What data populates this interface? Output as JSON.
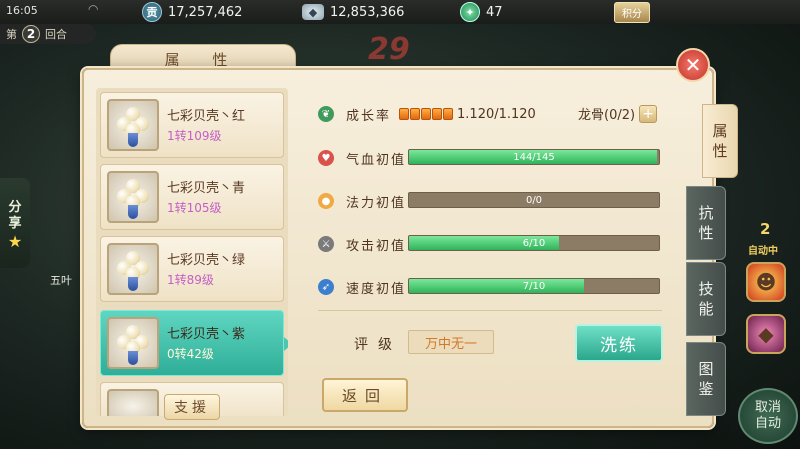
{
  "status_bar": {
    "time": "16:05",
    "gong_icon_char": "贡",
    "gong_value": "17,257,462",
    "silver_value": "12,853,366",
    "jade_value": "47",
    "points_label": "积分"
  },
  "battle": {
    "round_prefix": "第",
    "round_number": "2",
    "round_suffix": "回合",
    "big_number": "29",
    "share_label_1": "分",
    "share_label_2": "享",
    "side_unit_name": "五叶",
    "auto_count": "2",
    "auto_label": "自动中",
    "cancel_auto_label_1": "取消",
    "cancel_auto_label_2": "自动"
  },
  "panel": {
    "title": "属 性",
    "close_icon": "✕"
  },
  "pets": [
    {
      "name": "七彩贝壳丶红",
      "level": "1转109级",
      "selected": false
    },
    {
      "name": "七彩贝壳丶青",
      "level": "1转105级",
      "selected": false
    },
    {
      "name": "七彩贝壳丶绿",
      "level": "1转89级",
      "selected": false
    },
    {
      "name": "七彩贝壳丶紫",
      "level": "0转42级",
      "selected": true
    }
  ],
  "assist_label": "支援",
  "attributes": {
    "growth": {
      "label": "成长率",
      "pips": 5,
      "value": "1.120/1.120"
    },
    "dragonbone": {
      "label": "龙骨(0/2)",
      "plus": "+"
    },
    "rows": [
      {
        "label": "气血初值",
        "text": "144/145",
        "fraction": 0.993,
        "icon": "heart-icon"
      },
      {
        "label": "法力初值",
        "text": "0/0",
        "fraction": 0,
        "icon": "mana-icon"
      },
      {
        "label": "攻击初值",
        "text": "6/10",
        "fraction": 0.6,
        "icon": "sword-icon"
      },
      {
        "label": "速度初值",
        "text": "7/10",
        "fraction": 0.7,
        "icon": "speed-icon"
      }
    ]
  },
  "rating": {
    "label": "评级",
    "value": "万中无一"
  },
  "buttons": {
    "wash": "洗练",
    "back": "返回"
  },
  "side_tabs": [
    {
      "label_1": "属",
      "label_2": "性",
      "active": true
    },
    {
      "label_1": "抗",
      "label_2": "性",
      "active": false
    },
    {
      "label_1": "技",
      "label_2": "能",
      "active": false
    },
    {
      "label_1": "图",
      "label_2": "鉴",
      "active": false
    }
  ],
  "colors": {
    "selected_item": "#2fae98",
    "bar_fill": "#2fb35a",
    "level_text": "#c65fc4",
    "rating_text": "#d07a2a"
  }
}
